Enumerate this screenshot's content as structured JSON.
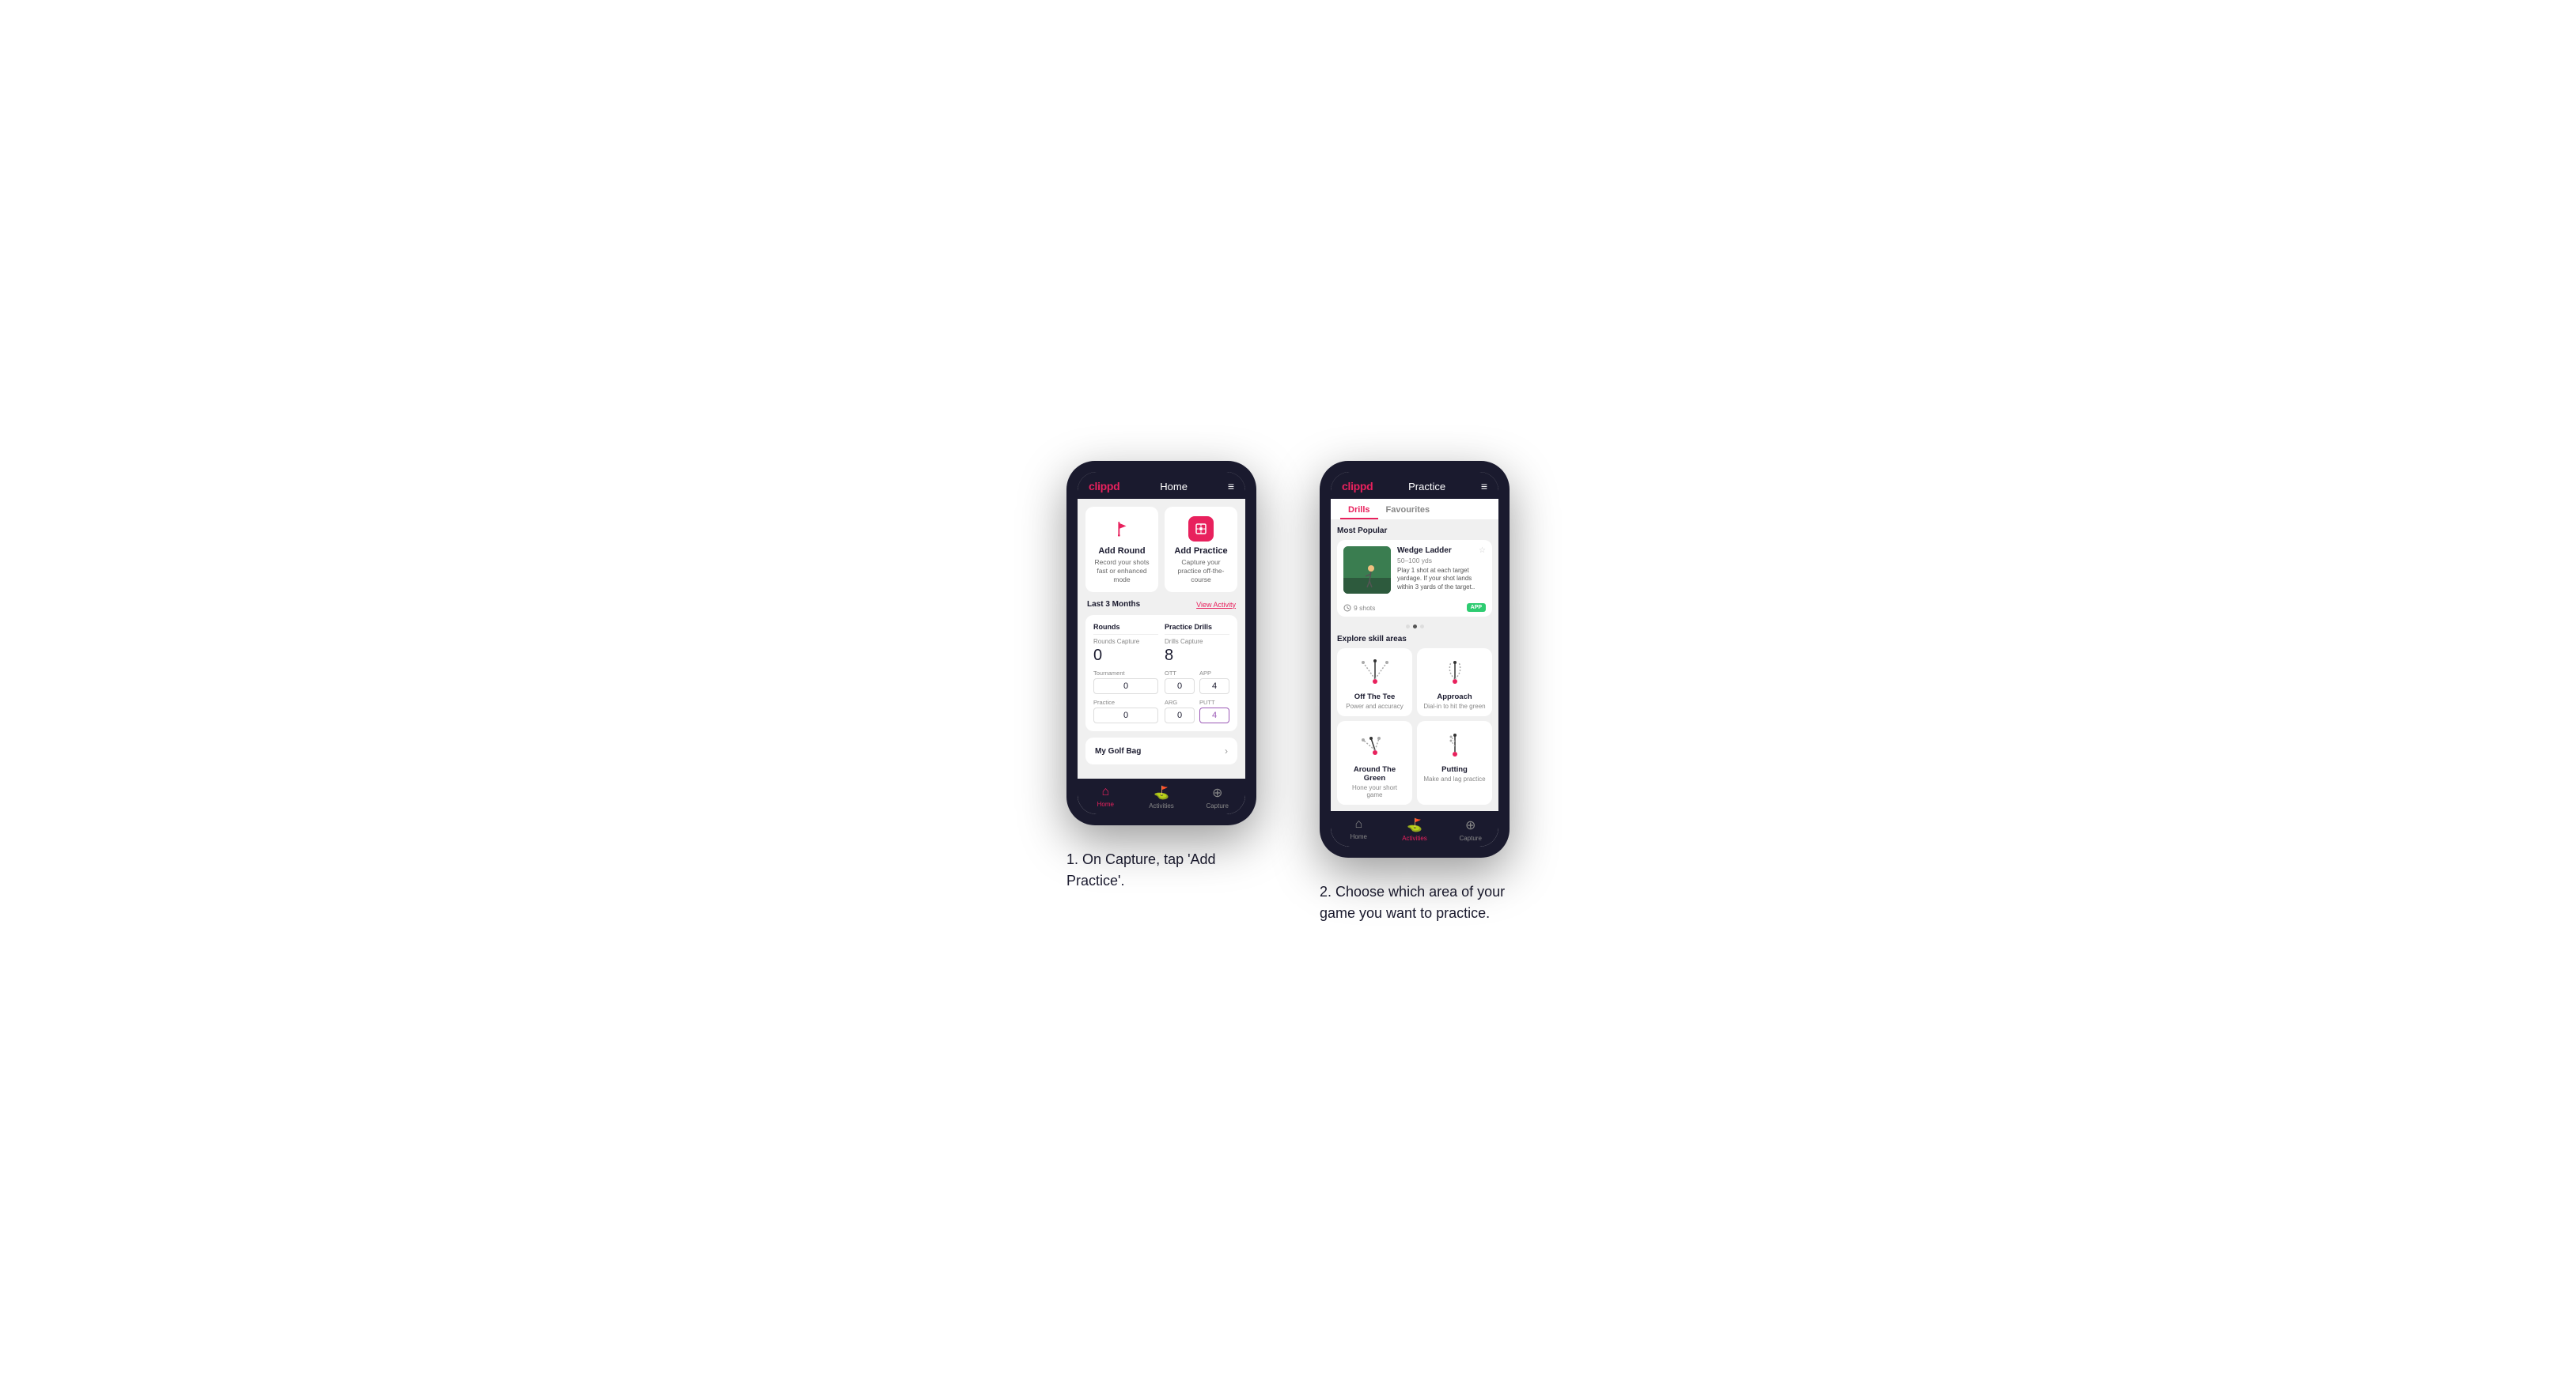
{
  "phone1": {
    "header": {
      "logo": "clippd",
      "title": "Home",
      "menu_icon": "≡"
    },
    "action_cards": [
      {
        "id": "add-round",
        "title": "Add Round",
        "description": "Record your shots fast or enhanced mode",
        "icon_type": "flag"
      },
      {
        "id": "add-practice",
        "title": "Add Practice",
        "description": "Capture your practice off-the-course",
        "icon_type": "practice"
      }
    ],
    "stats": {
      "period_label": "Last 3 Months",
      "view_activity_label": "View Activity",
      "rounds": {
        "title": "Rounds",
        "capture_label": "Rounds Capture",
        "value": "0",
        "sub_items": [
          {
            "label": "Tournament",
            "value": "0"
          },
          {
            "label": "Practice",
            "value": "0"
          }
        ]
      },
      "practice_drills": {
        "title": "Practice Drills",
        "capture_label": "Drills Capture",
        "value": "8",
        "sub_items": [
          {
            "label": "OTT",
            "value": "0"
          },
          {
            "label": "APP",
            "value": "4",
            "highlight": false
          },
          {
            "label": "ARG",
            "value": "0"
          },
          {
            "label": "PUTT",
            "value": "4",
            "highlight": true
          }
        ]
      }
    },
    "golf_bag": {
      "label": "My Golf Bag"
    },
    "nav": {
      "items": [
        {
          "id": "home",
          "label": "Home",
          "icon": "⌂",
          "active": true
        },
        {
          "id": "activities",
          "label": "Activities",
          "icon": "♣",
          "active": false
        },
        {
          "id": "capture",
          "label": "Capture",
          "icon": "⊕",
          "active": false
        }
      ]
    }
  },
  "phone2": {
    "header": {
      "logo": "clippd",
      "title": "Practice",
      "menu_icon": "≡"
    },
    "tabs": [
      {
        "label": "Drills",
        "active": true
      },
      {
        "label": "Favourites",
        "active": false
      }
    ],
    "most_popular": {
      "section_title": "Most Popular",
      "drill": {
        "name": "Wedge Ladder",
        "yardage": "50–100 yds",
        "description": "Play 1 shot at each target yardage. If your shot lands within 3 yards of the target..",
        "shots_count": "9 shots",
        "badge": "APP"
      },
      "dots": [
        {
          "active": false
        },
        {
          "active": true
        },
        {
          "active": false
        }
      ]
    },
    "skill_areas": {
      "section_title": "Explore skill areas",
      "items": [
        {
          "id": "off-the-tee",
          "name": "Off The Tee",
          "description": "Power and accuracy",
          "diagram_type": "arc-lines"
        },
        {
          "id": "approach",
          "name": "Approach",
          "description": "Dial-in to hit the green",
          "diagram_type": "approach-lines"
        },
        {
          "id": "around-the-green",
          "name": "Around The Green",
          "description": "Hone your short game",
          "diagram_type": "arc-short"
        },
        {
          "id": "putting",
          "name": "Putting",
          "description": "Make and lag practice",
          "diagram_type": "putt-lines"
        }
      ]
    },
    "nav": {
      "items": [
        {
          "id": "home",
          "label": "Home",
          "icon": "⌂",
          "active": false
        },
        {
          "id": "activities",
          "label": "Activities",
          "icon": "♣",
          "active": true
        },
        {
          "id": "capture",
          "label": "Capture",
          "icon": "⊕",
          "active": false
        }
      ]
    }
  },
  "captions": {
    "phone1": "1. On Capture, tap 'Add Practice'.",
    "phone2": "2. Choose which area of your game you want to practice."
  },
  "colors": {
    "brand_red": "#e8215d",
    "dark_bg": "#1a1a2e",
    "light_bg": "#f0f0f0"
  }
}
